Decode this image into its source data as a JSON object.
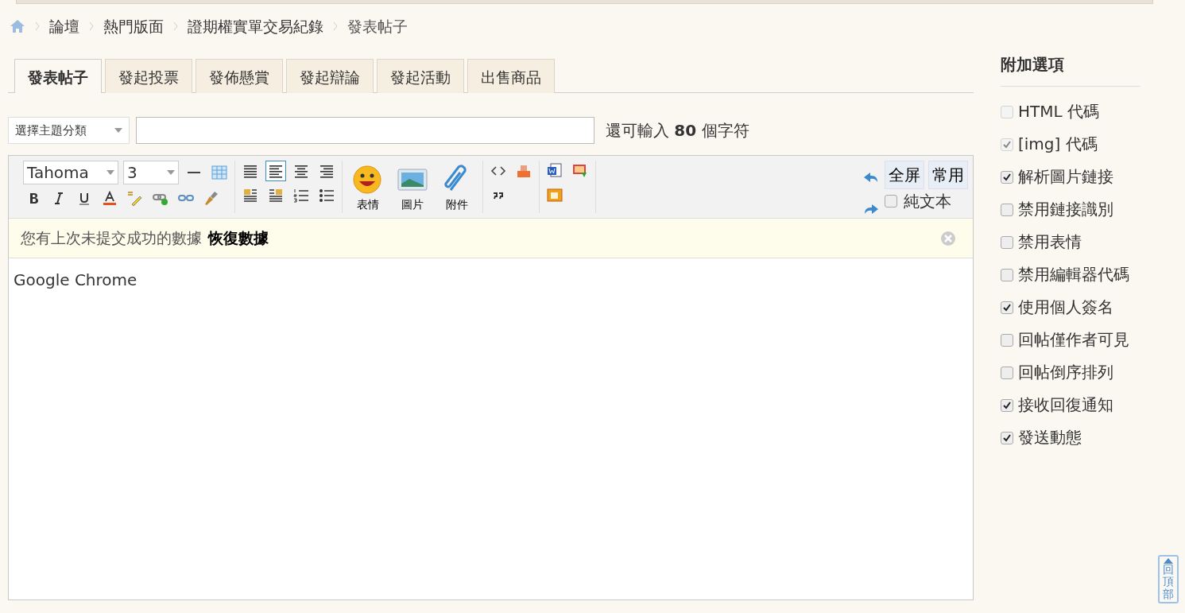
{
  "breadcrumb": [
    "論壇",
    "熱門版面",
    "證期權實單交易紀錄",
    "發表帖子"
  ],
  "tabs": [
    {
      "label": "發表帖子",
      "selected": true
    },
    {
      "label": "發起投票",
      "selected": false
    },
    {
      "label": "發佈懸賞",
      "selected": false
    },
    {
      "label": "發起辯論",
      "selected": false
    },
    {
      "label": "發起活動",
      "selected": false
    },
    {
      "label": "出售商品",
      "selected": false
    }
  ],
  "subject": {
    "category": "選擇主題分類",
    "remaining": "還可輸入 **80** 個字符"
  },
  "editor": {
    "font": "Tahoma",
    "size": "3",
    "align": [
      {
        "selected": false
      },
      {
        "selected": true
      },
      {
        "selected": false
      },
      {
        "selected": false
      }
    ],
    "big_buttons": [
      "表情",
      "圖片",
      "附件"
    ],
    "fullscreen": "全屏",
    "common": "常用",
    "plain_text": {
      "label": "純文本",
      "checked": false
    },
    "notice": "您有上次未提交成功的數據",
    "restore": "恢復數據",
    "content": "Google Chrome"
  },
  "options": {
    "title": "附加選項",
    "items": [
      {
        "label": "HTML 代碼",
        "checked": false,
        "disabled": true
      },
      {
        "label": "[img] 代碼",
        "checked": true,
        "disabled": true
      },
      {
        "label": "解析圖片鏈接",
        "checked": true,
        "disabled": false
      },
      {
        "label": "禁用鏈接識別",
        "checked": false,
        "disabled": false
      },
      {
        "label": "禁用表情",
        "checked": false,
        "disabled": false
      },
      {
        "label": "禁用編輯器代碼",
        "checked": false,
        "disabled": false
      },
      {
        "label": "使用個人簽名",
        "checked": true,
        "disabled": false
      },
      {
        "label": "回帖僅作者可見",
        "checked": false,
        "disabled": false
      },
      {
        "label": "回帖倒序排列",
        "checked": false,
        "disabled": false
      },
      {
        "label": "接收回復通知",
        "checked": true,
        "disabled": false
      },
      {
        "label": "發送動態",
        "checked": true,
        "disabled": false
      }
    ]
  },
  "back_to_top": "回頂部"
}
